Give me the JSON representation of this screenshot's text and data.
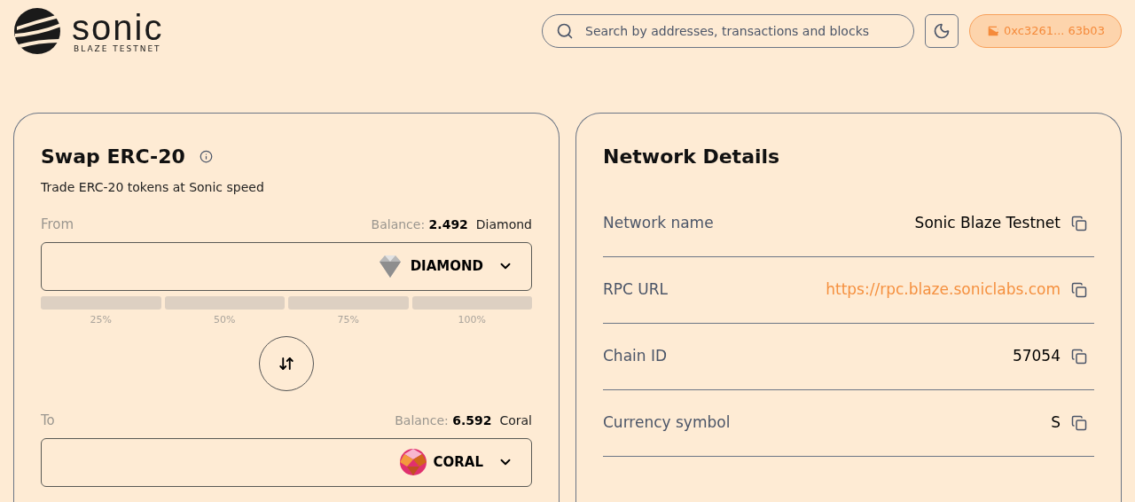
{
  "header": {
    "logo": {
      "name": "sonic",
      "subtitle": "BLAZE TESTNET"
    },
    "search": {
      "placeholder": "Search by addresses, transactions and blocks"
    },
    "wallet": {
      "address": "0xc3261... 63b03"
    }
  },
  "swap": {
    "title": "Swap ERC-20",
    "subtitle": "Trade ERC-20 tokens at Sonic speed",
    "from": {
      "label": "From",
      "balance_label": "Balance:",
      "balance": "2.492",
      "unit": "Diamond",
      "token": "DIAMOND",
      "kind": "diamond"
    },
    "percents": [
      "25%",
      "50%",
      "75%",
      "100%"
    ],
    "to": {
      "label": "To",
      "balance_label": "Balance:",
      "balance": "6.592",
      "unit": "Coral",
      "token": "CORAL",
      "kind": "coral"
    }
  },
  "network": {
    "title": "Network Details",
    "rows": [
      {
        "label": "Network name",
        "value": "Sonic Blaze Testnet",
        "kind": "text"
      },
      {
        "label": "RPC URL",
        "value": "https://rpc.blaze.soniclabs.com",
        "kind": "link"
      },
      {
        "label": "Chain ID",
        "value": "57054",
        "kind": "text"
      },
      {
        "label": "Currency symbol",
        "value": "S",
        "kind": "text"
      }
    ]
  }
}
